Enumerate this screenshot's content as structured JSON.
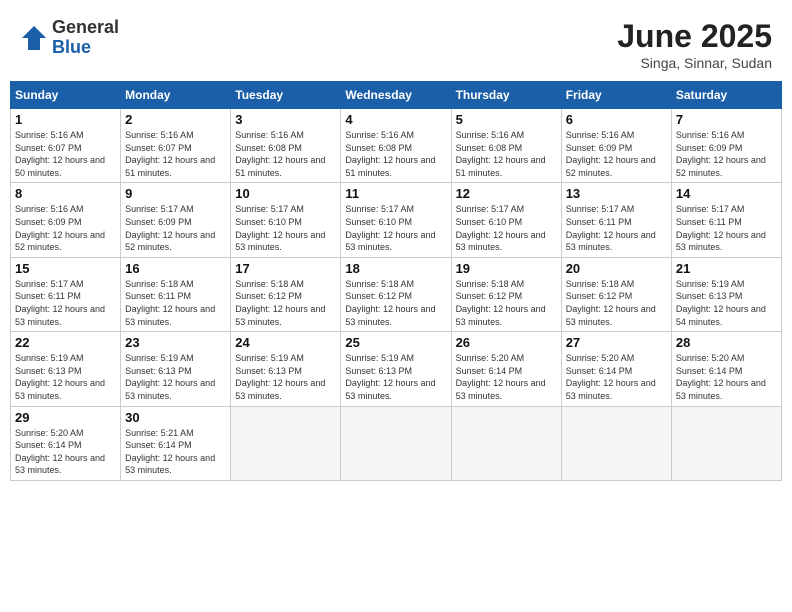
{
  "logo": {
    "general": "General",
    "blue": "Blue"
  },
  "title": "June 2025",
  "location": "Singa, Sinnar, Sudan",
  "days_of_week": [
    "Sunday",
    "Monday",
    "Tuesday",
    "Wednesday",
    "Thursday",
    "Friday",
    "Saturday"
  ],
  "weeks": [
    [
      {
        "day": "1",
        "sunrise": "5:16 AM",
        "sunset": "6:07 PM",
        "daylight": "12 hours and 50 minutes."
      },
      {
        "day": "2",
        "sunrise": "5:16 AM",
        "sunset": "6:07 PM",
        "daylight": "12 hours and 51 minutes."
      },
      {
        "day": "3",
        "sunrise": "5:16 AM",
        "sunset": "6:08 PM",
        "daylight": "12 hours and 51 minutes."
      },
      {
        "day": "4",
        "sunrise": "5:16 AM",
        "sunset": "6:08 PM",
        "daylight": "12 hours and 51 minutes."
      },
      {
        "day": "5",
        "sunrise": "5:16 AM",
        "sunset": "6:08 PM",
        "daylight": "12 hours and 51 minutes."
      },
      {
        "day": "6",
        "sunrise": "5:16 AM",
        "sunset": "6:09 PM",
        "daylight": "12 hours and 52 minutes."
      },
      {
        "day": "7",
        "sunrise": "5:16 AM",
        "sunset": "6:09 PM",
        "daylight": "12 hours and 52 minutes."
      }
    ],
    [
      {
        "day": "8",
        "sunrise": "5:16 AM",
        "sunset": "6:09 PM",
        "daylight": "12 hours and 52 minutes."
      },
      {
        "day": "9",
        "sunrise": "5:17 AM",
        "sunset": "6:09 PM",
        "daylight": "12 hours and 52 minutes."
      },
      {
        "day": "10",
        "sunrise": "5:17 AM",
        "sunset": "6:10 PM",
        "daylight": "12 hours and 53 minutes."
      },
      {
        "day": "11",
        "sunrise": "5:17 AM",
        "sunset": "6:10 PM",
        "daylight": "12 hours and 53 minutes."
      },
      {
        "day": "12",
        "sunrise": "5:17 AM",
        "sunset": "6:10 PM",
        "daylight": "12 hours and 53 minutes."
      },
      {
        "day": "13",
        "sunrise": "5:17 AM",
        "sunset": "6:11 PM",
        "daylight": "12 hours and 53 minutes."
      },
      {
        "day": "14",
        "sunrise": "5:17 AM",
        "sunset": "6:11 PM",
        "daylight": "12 hours and 53 minutes."
      }
    ],
    [
      {
        "day": "15",
        "sunrise": "5:17 AM",
        "sunset": "6:11 PM",
        "daylight": "12 hours and 53 minutes."
      },
      {
        "day": "16",
        "sunrise": "5:18 AM",
        "sunset": "6:11 PM",
        "daylight": "12 hours and 53 minutes."
      },
      {
        "day": "17",
        "sunrise": "5:18 AM",
        "sunset": "6:12 PM",
        "daylight": "12 hours and 53 minutes."
      },
      {
        "day": "18",
        "sunrise": "5:18 AM",
        "sunset": "6:12 PM",
        "daylight": "12 hours and 53 minutes."
      },
      {
        "day": "19",
        "sunrise": "5:18 AM",
        "sunset": "6:12 PM",
        "daylight": "12 hours and 53 minutes."
      },
      {
        "day": "20",
        "sunrise": "5:18 AM",
        "sunset": "6:12 PM",
        "daylight": "12 hours and 53 minutes."
      },
      {
        "day": "21",
        "sunrise": "5:19 AM",
        "sunset": "6:13 PM",
        "daylight": "12 hours and 54 minutes."
      }
    ],
    [
      {
        "day": "22",
        "sunrise": "5:19 AM",
        "sunset": "6:13 PM",
        "daylight": "12 hours and 53 minutes."
      },
      {
        "day": "23",
        "sunrise": "5:19 AM",
        "sunset": "6:13 PM",
        "daylight": "12 hours and 53 minutes."
      },
      {
        "day": "24",
        "sunrise": "5:19 AM",
        "sunset": "6:13 PM",
        "daylight": "12 hours and 53 minutes."
      },
      {
        "day": "25",
        "sunrise": "5:19 AM",
        "sunset": "6:13 PM",
        "daylight": "12 hours and 53 minutes."
      },
      {
        "day": "26",
        "sunrise": "5:20 AM",
        "sunset": "6:14 PM",
        "daylight": "12 hours and 53 minutes."
      },
      {
        "day": "27",
        "sunrise": "5:20 AM",
        "sunset": "6:14 PM",
        "daylight": "12 hours and 53 minutes."
      },
      {
        "day": "28",
        "sunrise": "5:20 AM",
        "sunset": "6:14 PM",
        "daylight": "12 hours and 53 minutes."
      }
    ],
    [
      {
        "day": "29",
        "sunrise": "5:20 AM",
        "sunset": "6:14 PM",
        "daylight": "12 hours and 53 minutes."
      },
      {
        "day": "30",
        "sunrise": "5:21 AM",
        "sunset": "6:14 PM",
        "daylight": "12 hours and 53 minutes."
      },
      null,
      null,
      null,
      null,
      null
    ]
  ]
}
